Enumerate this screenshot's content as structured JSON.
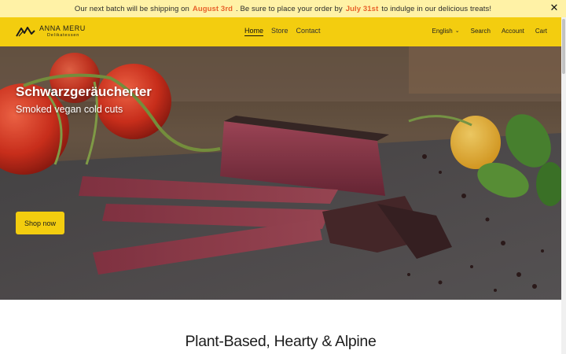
{
  "announcement": {
    "text_before": "Our next batch will be shipping on",
    "ship_date": "August 3rd",
    "text_middle": ". Be sure to place your order by",
    "order_date": "July 31st",
    "text_after": "to indulge in our delicious treats!",
    "close_icon": "close-icon",
    "close_glyph": "✕"
  },
  "header": {
    "brand_name": "ANNA MERU",
    "brand_sub": "Delikatessen",
    "nav": [
      "Home",
      "Store",
      "Contact"
    ],
    "language": "English",
    "search": "Search",
    "account": "Account",
    "cart": "Cart"
  },
  "hero": {
    "title": "Schwarzgeräucherter",
    "subtitle": "Smoked vegan cold cuts",
    "button": "Shop now"
  },
  "section": {
    "title": "Plant-Based, Hearty & Alpine"
  },
  "colors": {
    "brand_yellow": "#f3cd0f",
    "announcement_bg": "#fff2a6",
    "highlight": "#e8622a"
  }
}
